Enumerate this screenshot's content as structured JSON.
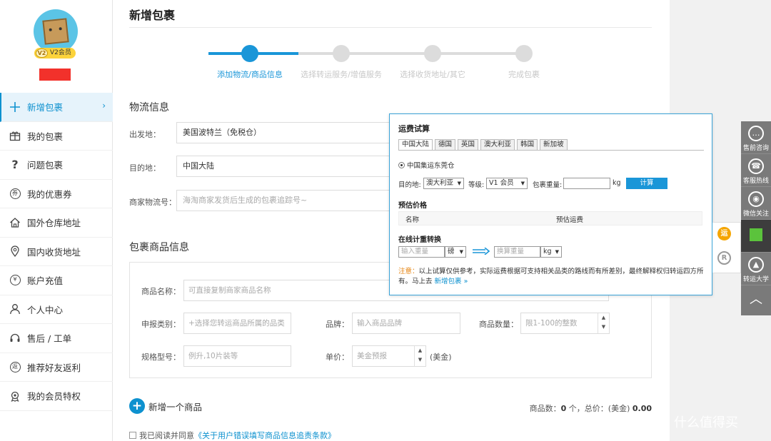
{
  "sidebar": {
    "vip_badge": "V2会员",
    "vip_level": "V2",
    "items": [
      {
        "label": "新增包裹",
        "icon": "plus-icon",
        "active": true
      },
      {
        "label": "我的包裹",
        "icon": "gift-box-icon"
      },
      {
        "label": "问题包裹",
        "icon": "question-icon"
      },
      {
        "label": "我的优惠券",
        "icon": "coupon-icon"
      },
      {
        "label": "国外仓库地址",
        "icon": "home-icon"
      },
      {
        "label": "国内收货地址",
        "icon": "location-pin-icon"
      },
      {
        "label": "账户充值",
        "icon": "yen-icon"
      },
      {
        "label": "个人中心",
        "icon": "person-icon"
      },
      {
        "label": "售后 / 工单",
        "icon": "headset-icon"
      },
      {
        "label": "推荐好友返利",
        "icon": "refer-friend-icon"
      },
      {
        "label": "我的会员特权",
        "icon": "member-badge-icon"
      }
    ]
  },
  "main": {
    "title": "新增包裹",
    "steps": [
      {
        "label": "添加物流/商品信息",
        "active": true
      },
      {
        "label": "选择转运服务/增值服务",
        "active": false
      },
      {
        "label": "选择收货地址/其它",
        "active": false
      },
      {
        "label": "完成包裹",
        "active": false
      }
    ],
    "logistics": {
      "title": "物流信息",
      "origin_label": "出发地：",
      "origin_value": "美国波特兰（免税仓）",
      "dest_label": "目的地：",
      "dest_value": "中国大陆",
      "tracking_label": "商家物流号：",
      "tracking_placeholder": "海淘商家发货后生成的包裹追踪号~"
    },
    "goods": {
      "title": "包裹商品信息",
      "name_label": "商品名称：",
      "name_placeholder": "可直接复制商家商品名称",
      "category_label": "申报类别：",
      "category_placeholder": "+选择您转运商品所属的品类",
      "brand_label": "品牌：",
      "brand_placeholder": "输入商品品牌",
      "qty_label": "商品数量：",
      "qty_placeholder": "限1-100的整数",
      "spec_label": "规格型号：",
      "spec_placeholder": "例升,10片装等",
      "price_label": "单价：",
      "price_placeholder": "美金预报",
      "price_unit": "(美金)"
    },
    "add_goods_label": "新增一个商品",
    "summary_prefix": "商品数：",
    "summary_count": "0",
    "summary_mid": " 个，总价：(美金) ",
    "summary_total": "0.00",
    "agree_text": "我已阅读并同意",
    "agree_link": "《关于用户错误填写商品信息追责条款》"
  },
  "popup": {
    "title": "运费试算",
    "tabs": [
      "中国大陆",
      "德国",
      "英国",
      "澳大利亚",
      "韩国",
      "新加坡"
    ],
    "warehouse_radio": "中国集运东莞仓",
    "dest_label": "目的地:",
    "dest_value": "澳大利亚",
    "grade_label": "等级:",
    "grade_value": "V1 会员",
    "weight_label": "包裹重量:",
    "weight_unit": "kg",
    "calc_button": "计算",
    "estimate_title": "预估价格",
    "col_name": "名称",
    "col_fee": "预估运费",
    "convert_title": "在线计重转换",
    "input_weight_placeholder": "输入重量",
    "unit_from": "磅",
    "converted_placeholder": "换算重量",
    "unit_to": "kg",
    "note_warn": "注意：",
    "note_text": "以上试算仅供参考，实际运费根据可支持相关品类的路线而有所差别，最终解释权归转运四方所有。马上去",
    "note_link": "新增包裹 »"
  },
  "float": {
    "yun_label": "运",
    "r_label": "R"
  },
  "right_bar": [
    {
      "label": "售前咨询",
      "icon": "chat-icon"
    },
    {
      "label": "客服热线",
      "icon": "headset-icon"
    },
    {
      "label": "微信关注",
      "icon": "wechat-icon"
    },
    {
      "label": "",
      "icon": "qr-code-icon"
    },
    {
      "label": "转运大学",
      "icon": "graduation-cap-icon"
    }
  ],
  "watermark": {
    "glyph": "值",
    "text": "什么值得买"
  },
  "colors": {
    "accent": "#0d91cf",
    "step_active": "#1a96d8",
    "step_inactive": "#dcdcdc",
    "badge": "#fcd33b",
    "warn": "#e5820d"
  }
}
